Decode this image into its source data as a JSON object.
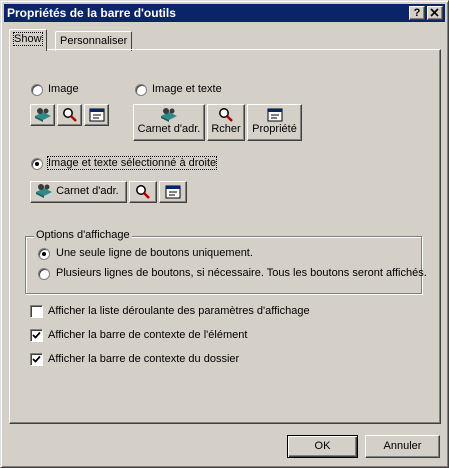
{
  "window": {
    "title": "Propriétés de la barre d'outils",
    "help_btn": "?",
    "close_btn": "✕"
  },
  "tabs": [
    {
      "label": "Show"
    },
    {
      "label": "Personnaliser"
    }
  ],
  "show": {
    "option_image": {
      "label": "Image",
      "selected": false
    },
    "option_image_text": {
      "label": "Image et texte",
      "selected": false
    },
    "option_image_text_right": {
      "label": "Image et texte sélectionné à droite",
      "selected": true
    },
    "preview_text_buttons": [
      "Carnet d'adr.",
      "Rcher",
      "Propriété"
    ],
    "preview_right_label": "Carnet d'adr.",
    "options_group": {
      "title": "Options d'affichage",
      "single_line": {
        "label": "Une seule ligne de boutons uniquement.",
        "selected": true
      },
      "multi_line": {
        "label": "Plusieurs lignes de boutons, si nécessaire. Tous les boutons seront affichés.",
        "selected": false
      }
    },
    "checkboxes": [
      {
        "label": "Afficher la liste déroulante des paramètres d'affichage",
        "checked": false
      },
      {
        "label": "Afficher la barre de contexte de l'élément",
        "checked": true
      },
      {
        "label": "Afficher la barre de contexte du dossier",
        "checked": true
      }
    ]
  },
  "buttons": {
    "ok": "OK",
    "cancel": "Annuler"
  },
  "icons": [
    "address-book-icon",
    "search-icon",
    "properties-icon"
  ]
}
